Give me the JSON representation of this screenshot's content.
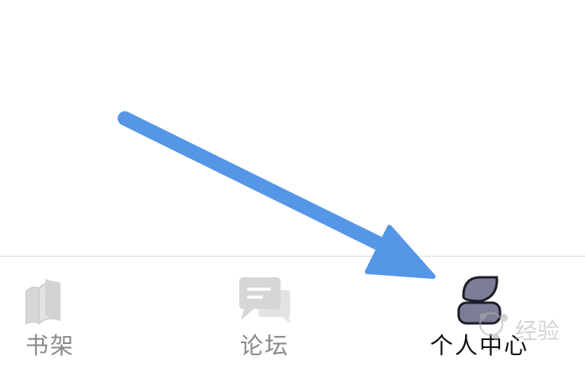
{
  "tabs": [
    {
      "id": "bookshelf",
      "label": "书架",
      "icon": "book-icon",
      "active": false
    },
    {
      "id": "forum",
      "label": "论坛",
      "icon": "chat-icon",
      "active": false
    },
    {
      "id": "profile",
      "label": "个人中心",
      "icon": "person-icon",
      "active": true
    }
  ],
  "colors": {
    "inactive": "#8a8a8a",
    "active": "#111111",
    "profile_icon_fill": "#7b7e96",
    "annotation_arrow": "#5596e6",
    "divider": "#dcdcdc"
  },
  "watermark_text": "经验"
}
